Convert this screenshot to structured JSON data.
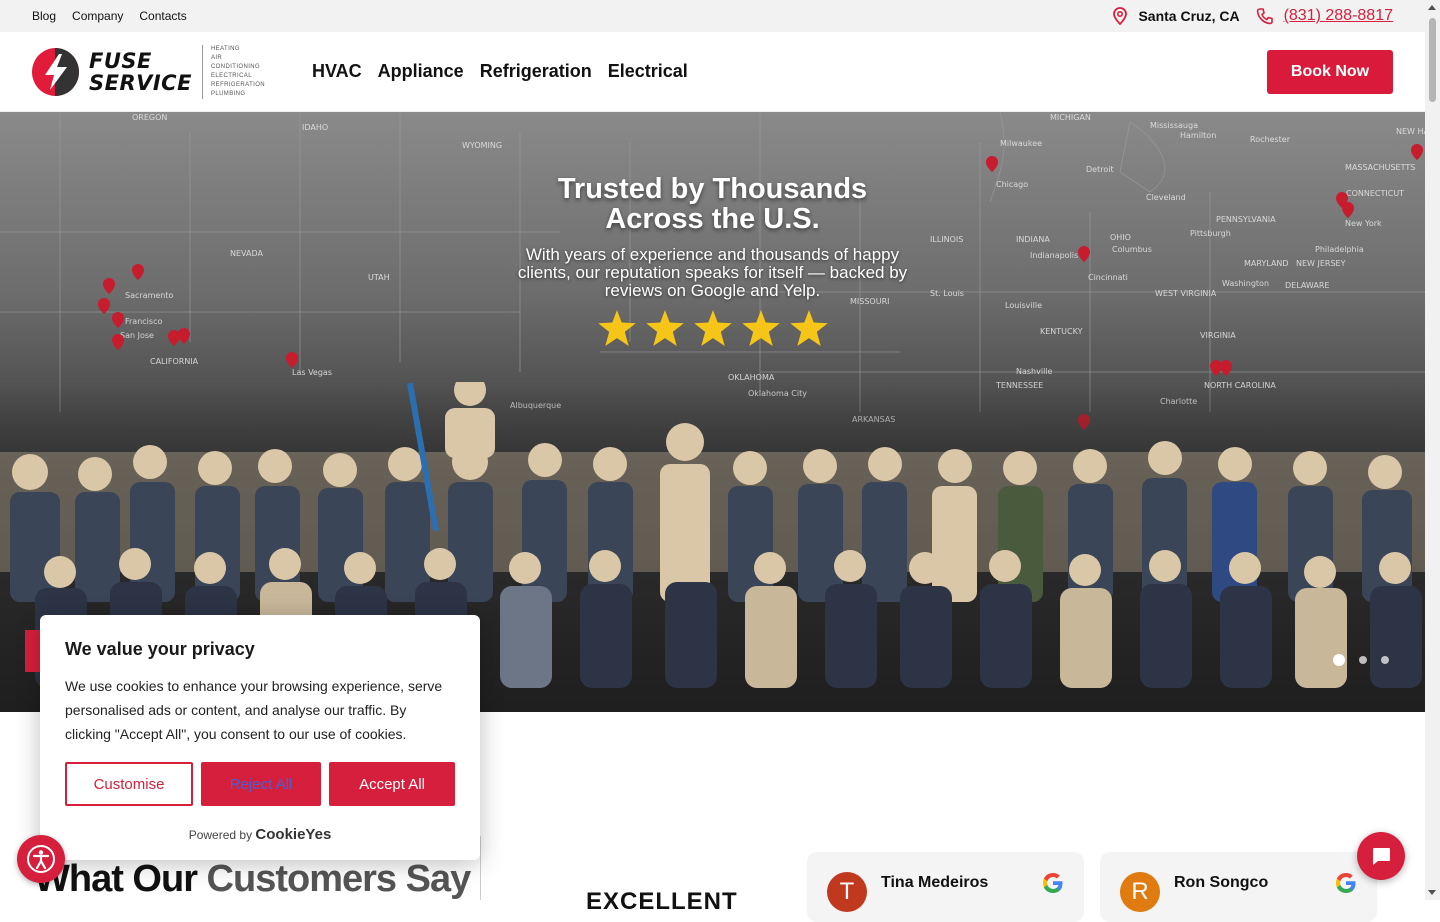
{
  "topbar": {
    "links": [
      "Blog",
      "Company",
      "Contacts"
    ],
    "location": "Santa Cruz, CA",
    "phone": "(831) 288-8817"
  },
  "header": {
    "logo_line1": "FUSE",
    "logo_line2": "SERVICE",
    "logo_tags": [
      "HEATING",
      "AIR CONDITIONING",
      "ELECTRICAL",
      "REFRIGERATION",
      "PLUMBING"
    ],
    "nav": [
      "HVAC",
      "Appliance",
      "Refrigeration",
      "Electrical"
    ],
    "book_label": "Book Now"
  },
  "hero": {
    "title_line1": "Trusted by Thousands",
    "title_line2": "Across the U.S.",
    "subtitle": "With years of experience and thousands of happy clients, our reputation speaks for itself — backed by reviews on Google and Yelp.",
    "stars": 5,
    "slide_count": 3,
    "active_slide": 1,
    "map_labels": [
      "OREGON",
      "IDAHO",
      "WYOMING",
      "NEVADA",
      "UTAH",
      "CALIFORNIA",
      "Sacramento",
      "San Jose",
      "Francisco",
      "Las Vegas",
      "MICHIGAN",
      "Milwaukee",
      "Chicago",
      "Detroit",
      "Cleveland",
      "Pittsburgh",
      "Indianapolis",
      "Columbus",
      "Cincinnati",
      "New York",
      "Philadelphia",
      "Washington",
      "St. Louis",
      "Louisville",
      "Nashville",
      "Charlotte",
      "Oklahoma City",
      "Albuquerque",
      "KENTUCKY",
      "TENNESSEE",
      "VIRGINIA",
      "PENNSYLVANIA",
      "MASSACHUSETTS",
      "ILLINOIS",
      "INDIANA",
      "OHIO",
      "MISSOURI",
      "ARKANSAS",
      "OKLAHOMA",
      "NORTH CAROLINA",
      "WEST VIRGINIA",
      "MARYLAND",
      "NEW JERSEY",
      "DELAWARE",
      "CONNECTICUT",
      "NEW HAMPSHIRE",
      "Mississauga",
      "Hamilton",
      "Rochester"
    ]
  },
  "reviews_section": {
    "title_dark": "What Our",
    "title_grey": "Customers Say",
    "rating_word": "EXCELLENT",
    "reviews": [
      {
        "initial": "T",
        "name": "Tina Medeiros",
        "color": "#c0391f"
      },
      {
        "initial": "R",
        "name": "Ron Songco",
        "color": "#e07b12"
      }
    ]
  },
  "cookie": {
    "title": "We value your privacy",
    "body": "We use cookies to enhance your browsing experience, serve personalised ads or content, and analyse our traffic. By clicking \"Accept All\", you consent to our use of cookies.",
    "customise": "Customise",
    "reject": "Reject All",
    "accept": "Accept All",
    "powered_by": "Powered by",
    "brand": "CookieYes"
  },
  "colors": {
    "brand_red": "#d61f3c",
    "text_dark": "#111111"
  }
}
